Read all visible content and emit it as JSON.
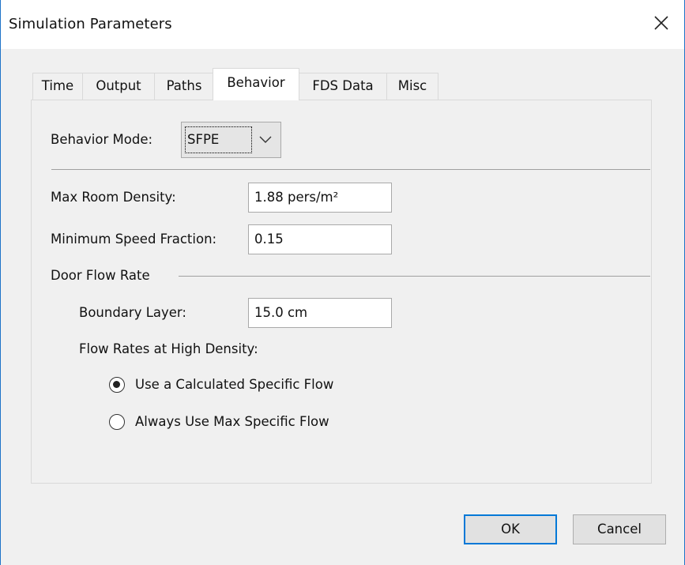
{
  "window": {
    "title": "Simulation Parameters"
  },
  "tabs": [
    {
      "label": "Time",
      "active": false
    },
    {
      "label": "Output",
      "active": false
    },
    {
      "label": "Paths",
      "active": false
    },
    {
      "label": "Behavior",
      "active": true
    },
    {
      "label": "FDS Data",
      "active": false
    },
    {
      "label": "Misc",
      "active": false
    }
  ],
  "behavior": {
    "mode_label": "Behavior Mode:",
    "mode_value": "SFPE",
    "max_room_density_label": "Max Room Density:",
    "max_room_density_value": "1.88 pers/m²",
    "min_speed_fraction_label": "Minimum Speed Fraction:",
    "min_speed_fraction_value": "0.15",
    "door_flow_rate_label": "Door Flow Rate",
    "boundary_layer_label": "Boundary Layer:",
    "boundary_layer_value": "15.0 cm",
    "flow_rates_label": "Flow Rates at High Density:",
    "options": [
      {
        "label": "Use a Calculated Specific Flow",
        "selected": true
      },
      {
        "label": "Always Use Max Specific Flow",
        "selected": false
      }
    ]
  },
  "buttons": {
    "ok": "OK",
    "cancel": "Cancel"
  },
  "colors": {
    "accent": "#0078d7",
    "window_border": "#1e73c8",
    "panel_bg": "#f0f0f0"
  },
  "icons": {
    "close": "close-icon",
    "dropdown": "chevron-down-icon"
  }
}
